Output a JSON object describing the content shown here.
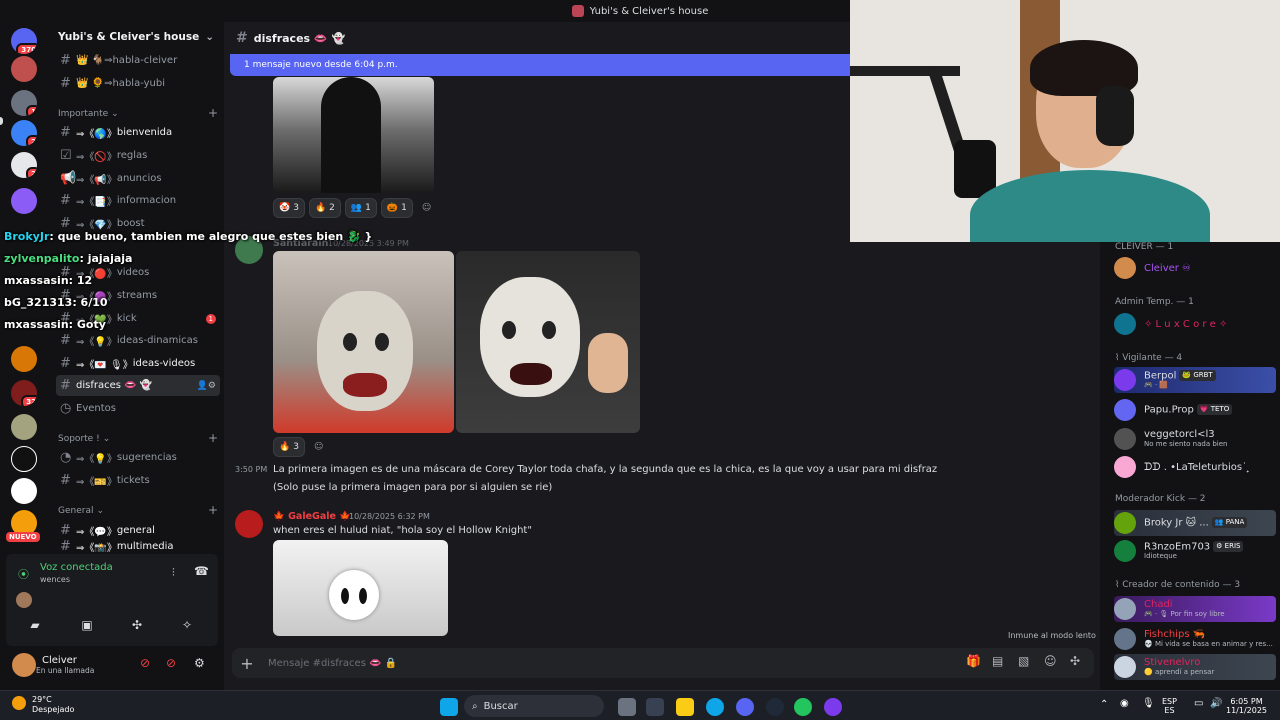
{
  "window": {
    "title": "Yubi's & Cleiver's house"
  },
  "guilds": {
    "badges": [
      "370",
      "1",
      "2",
      "2",
      "32"
    ],
    "new_label": "NUEVO"
  },
  "server": {
    "name": "Yubi's & Cleiver's house"
  },
  "channels": {
    "top": [
      {
        "prefix": "👑 🐐",
        "name": "⇒habla-cleiver"
      },
      {
        "prefix": "👑 🌻",
        "name": "⇒habla-yubi"
      }
    ],
    "cat_importante": "Importante",
    "importante": [
      {
        "prefix": "⇒《🌎》",
        "name": "bienvenida"
      },
      {
        "prefix": "⇒《🚫》",
        "name": "reglas"
      },
      {
        "prefix": "⇒《📢》",
        "name": "anuncios"
      },
      {
        "prefix": "⇒《📑》",
        "name": "informacion"
      },
      {
        "prefix": "⇒《💎》",
        "name": "boost"
      }
    ],
    "mid": [
      {
        "prefix": "⇒《🔴》",
        "name": "videos"
      },
      {
        "prefix": "⇒《🟣》",
        "name": "streams"
      },
      {
        "prefix": "⇒《💚》",
        "name": "kick",
        "badge": "1"
      },
      {
        "prefix": "⇒《💡》",
        "name": "ideas-dinamicas"
      },
      {
        "prefix": "⇒《💌 🎙》",
        "name": "ideas-videos"
      },
      {
        "prefix": "",
        "name": "disfraces 👄 👻"
      },
      {
        "prefix": "",
        "name": "Eventos"
      }
    ],
    "cat_soporte": "Soporte !",
    "soporte": [
      {
        "prefix": "⇒《💡》",
        "name": "sugerencias"
      },
      {
        "prefix": "⇒《🎫》",
        "name": "tickets"
      }
    ],
    "cat_general": "General",
    "general": [
      {
        "prefix": "⇒《💬》",
        "name": "general"
      },
      {
        "prefix": "⇒《📸》",
        "name": "multimedia"
      }
    ]
  },
  "voice": {
    "status": "Voz conectada",
    "channel": "wences"
  },
  "user": {
    "name": "Cleiver",
    "status": "En una llamada"
  },
  "header": {
    "channel": "disfraces 👄 👻"
  },
  "new_messages": "1 mensaje nuevo desde 6:04 p.m.",
  "msg1": {
    "reactions": [
      {
        "e": "🤡",
        "n": "3"
      },
      {
        "e": "🔥",
        "n": "2"
      },
      {
        "e": "👥",
        "n": "1"
      },
      {
        "e": "🎃",
        "n": "1"
      }
    ]
  },
  "msg2": {
    "author": "Santiarain",
    "time": "10/28/2025 3:49 PM",
    "reactions": [
      {
        "e": "🔥",
        "n": "3"
      }
    ]
  },
  "msg3": {
    "time": "3:50 PM",
    "line1": "La primera imagen es de una máscara de Corey Taylor toda chafa, y la segunda que es la chica, es la que voy a usar para mi disfraz",
    "line2": "(Solo puse la primera imagen para por si alguien se rie)"
  },
  "msg4": {
    "author": "🍁 GaleGale 🍁",
    "time": "10/28/2025 6:32 PM",
    "text": "when eres el hulud niat, \"hola soy el Hollow Knight\""
  },
  "slowmode": "Inmune al modo lento",
  "composer": {
    "placeholder": "Mensaje #disfraces 👄 🔒"
  },
  "members": {
    "groups": [
      {
        "label": "CLEIVER — 1",
        "items": [
          {
            "name": "Cleiver ♾",
            "color": "#a855f7",
            "status": ""
          }
        ]
      },
      {
        "label": "Admin Temp. — 1",
        "items": [
          {
            "name": "✧ L u x C o r e ✧",
            "color": "#e0245e",
            "status": ""
          }
        ]
      },
      {
        "label": "⌇ Vigilante — 4",
        "items": [
          {
            "name": "Berpol",
            "tag": "🐸 GRBT",
            "color": "#f2f3f5",
            "status": "🎮 · 🟫"
          },
          {
            "name": "Papu.Prop",
            "tag": "💗 TETO",
            "color": "#f2f3f5",
            "status": ""
          },
          {
            "name": "veggetorcl<l3",
            "tag": "",
            "color": "#f2f3f5",
            "status": "No me siento nada bien"
          },
          {
            "name": "ᗪᗪ . •LaTeleturbios˙ ̟",
            "tag": "",
            "color": "#f2f3f5",
            "status": ""
          }
        ]
      },
      {
        "label": "Moderador Kick — 2",
        "items": [
          {
            "name": "Broky Jr 🐱 ...",
            "tag": "👥 PANA",
            "color": "#f2f3f5",
            "status": ""
          },
          {
            "name": "R3nzoEm703",
            "tag": "⚙ ERIS",
            "color": "#f2f3f5",
            "status": "Idioteque"
          }
        ]
      },
      {
        "label": "⌇ Creador de contenido — 3",
        "items": [
          {
            "name": "Chadi",
            "tag": "",
            "color": "#e0245e",
            "status": "🎮 · 🎙 Por fin soy libre"
          },
          {
            "name": "Fishchips 🦐",
            "tag": "",
            "color": "#f23f43",
            "status": "💀 Mi vida se basa en animar y res..."
          },
          {
            "name": "Stivenelvro",
            "tag": "",
            "color": "#e0245e",
            "status": "🟡 aprendí a pensar"
          }
        ]
      }
    ]
  },
  "stream_chat": [
    {
      "user": "BrokyJr",
      "text": ": que bueno, tambien me alegro que estes bien 🐉 }"
    },
    {
      "user": "zylvenpalito",
      "text": ": jajajaja"
    },
    {
      "user": "mxassasin",
      "text": ": 12"
    },
    {
      "user": "bG_321313",
      "text": ": 6/10"
    },
    {
      "user": "mxassasin",
      "text": ": Goty"
    }
  ],
  "taskbar": {
    "temp": "29°C",
    "weather": "Despejado",
    "search": "Buscar",
    "lang1": "ESP",
    "lang2": "ES",
    "time": "6:05 PM",
    "date": "11/1/2025"
  }
}
